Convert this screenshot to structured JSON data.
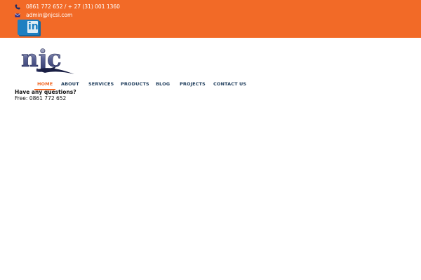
{
  "header": {
    "phone_text": "0861 772 652 / + 27 (31) 001 1360",
    "email_text": "admin@njcsi.com",
    "social": {
      "icon": "linkedin-icon"
    },
    "bg_color": "#f26a27"
  },
  "logo": {
    "text": "njc"
  },
  "nav": {
    "items": [
      "HOME",
      "ABOUT",
      "SERVICES",
      "PRODUCTS",
      "BLOG",
      "PROJECTS",
      "CONTACT US"
    ],
    "active": "HOME",
    "accent_color": "#f26a27"
  },
  "contact_block": {
    "question": "Have any questions?",
    "free": "Free: 0861 772 652"
  }
}
